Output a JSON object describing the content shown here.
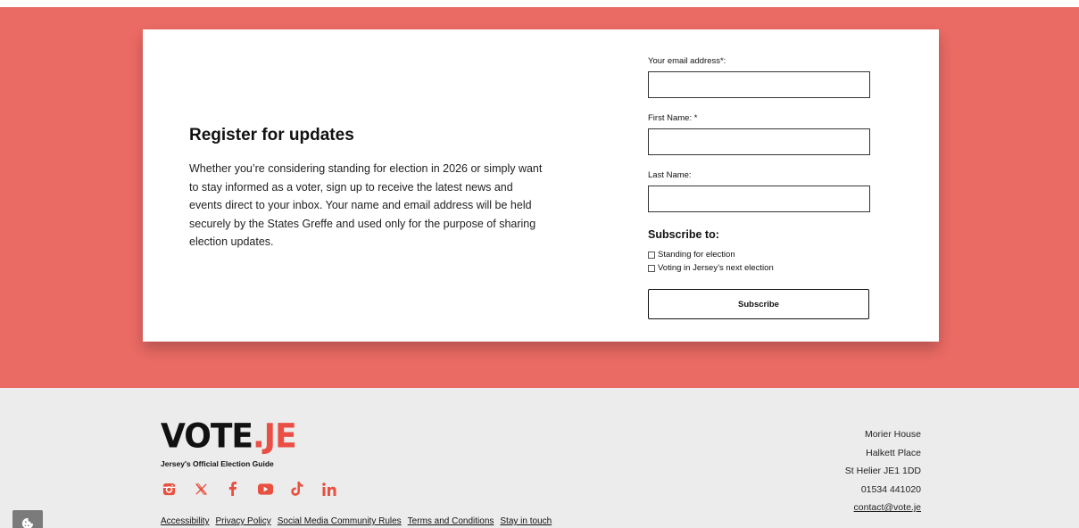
{
  "colors": {
    "hero_bg": "#ea6a64",
    "accent": "#ea4f46",
    "footer_bg": "#ececec"
  },
  "register": {
    "title": "Register for updates",
    "body": "Whether you’re considering standing for election in 2026 or simply want to stay informed as a voter, sign up to receive the latest news and events direct to your inbox. Your name and email address will be held securely by the States Greffe and used only for the purpose of sharing election updates."
  },
  "form": {
    "email_label": "Your email address*:",
    "email_value": "",
    "first_name_label": "First Name: *",
    "first_name_value": "",
    "last_name_label": "Last Name:",
    "last_name_value": "",
    "subscribe_heading": "Subscribe to:",
    "options": [
      {
        "label": "Standing for election",
        "checked": false
      },
      {
        "label": "Voting in Jersey’s next election",
        "checked": false
      }
    ],
    "submit_label": "Subscribe"
  },
  "footer": {
    "logo_vote": "VOTE",
    "logo_dot": ".",
    "logo_je": "JE",
    "tagline": "Jersey's Official Election Guide",
    "social_icons": [
      "instagram-icon",
      "x-icon",
      "facebook-icon",
      "youtube-icon",
      "tiktok-icon",
      "linkedin-icon"
    ],
    "links": [
      "Accessibility",
      "Privacy Policy",
      "Social Media Community Rules",
      "Terms and Conditions",
      "Stay in touch"
    ],
    "address": [
      "Morier House",
      "Halkett Place",
      "St Helier JE1 1DD",
      "01534 441020"
    ],
    "email": "contact@vote.je"
  }
}
